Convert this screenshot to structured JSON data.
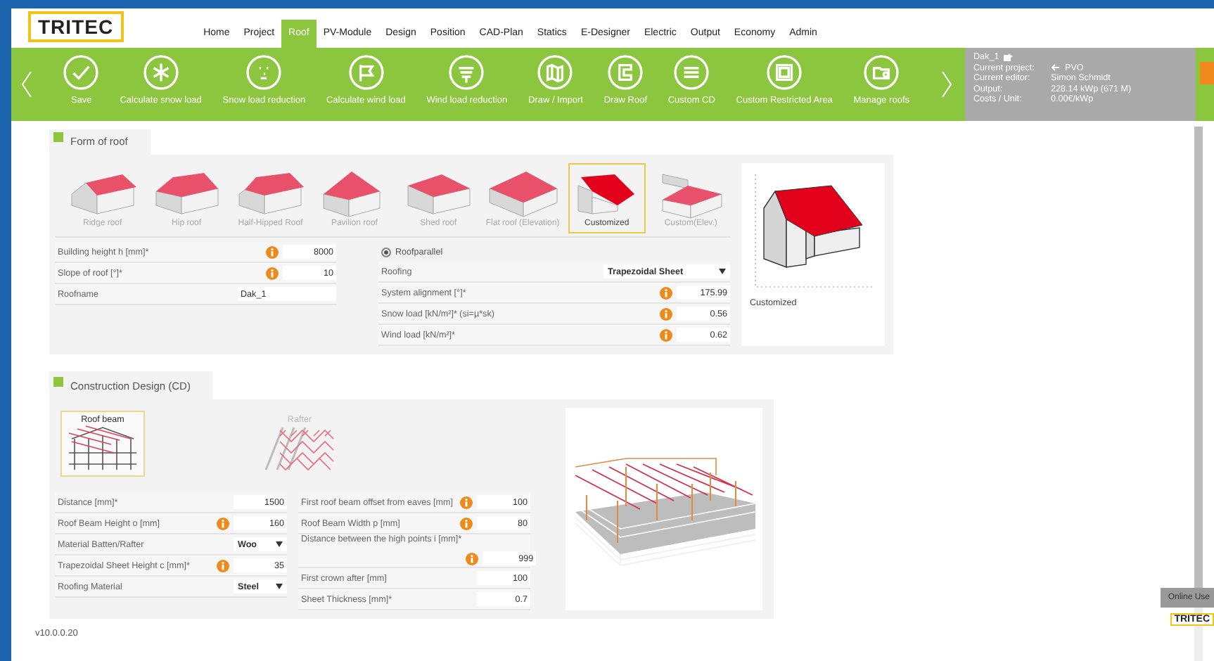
{
  "logo": "TRITEC",
  "nav": [
    {
      "label": "Home",
      "selected": false
    },
    {
      "label": "Project",
      "selected": false
    },
    {
      "label": "Roof",
      "selected": true
    },
    {
      "label": "PV-Module",
      "selected": false
    },
    {
      "label": "Design",
      "selected": false
    },
    {
      "label": "Position",
      "selected": false
    },
    {
      "label": "CAD-Plan",
      "selected": false
    },
    {
      "label": "Statics",
      "selected": false
    },
    {
      "label": "E-Designer",
      "selected": false
    },
    {
      "label": "Electric",
      "selected": false
    },
    {
      "label": "Output",
      "selected": false
    },
    {
      "label": "Economy",
      "selected": false
    },
    {
      "label": "Admin",
      "selected": false
    }
  ],
  "toolbar": [
    {
      "label": "Save"
    },
    {
      "label": "Calculate snow load"
    },
    {
      "label": "Snow load reduction"
    },
    {
      "label": "Calculate wind load"
    },
    {
      "label": "Wind load reduction"
    },
    {
      "label": "Draw / Import"
    },
    {
      "label": "Draw Roof"
    },
    {
      "label": "Custom CD"
    },
    {
      "label": "Custom Restricted Area"
    },
    {
      "label": "Manage roofs"
    }
  ],
  "info": {
    "roof": "Dak_1",
    "lines": [
      {
        "label": "Current project:",
        "value": "PVO",
        "icon": true
      },
      {
        "label": "Current editor:",
        "value": "Simon Schmidt",
        "icon": false
      },
      {
        "label": "Output:",
        "value": "228.14 kWp (671 M)",
        "icon": false
      },
      {
        "label": "Costs / Unit:",
        "value": "0.00€/kWp",
        "icon": false
      }
    ]
  },
  "roof_form": {
    "title": "Form of roof",
    "shapes": [
      {
        "label": "Ridge roof",
        "kind": "ridge",
        "selected": false
      },
      {
        "label": "Hip roof",
        "kind": "hip",
        "selected": false
      },
      {
        "label": "Half-Hipped Roof",
        "kind": "halfhip",
        "selected": false
      },
      {
        "label": "Pavilion roof",
        "kind": "pavilion",
        "selected": false
      },
      {
        "label": "Shed roof",
        "kind": "shed",
        "selected": false
      },
      {
        "label": "Flat roof (Elevation)",
        "kind": "flat",
        "selected": false
      },
      {
        "label": "Customized",
        "kind": "custom",
        "selected": true
      },
      {
        "label": "Custom(Elev.)",
        "kind": "customelev",
        "selected": false
      }
    ],
    "fields_left": [
      {
        "label": "Building height h [mm]*",
        "info": true,
        "kind": "number",
        "value": "8000"
      },
      {
        "label": "Slope of roof [°]*",
        "info": true,
        "kind": "number",
        "value": "10"
      },
      {
        "label": "Roofname",
        "info": false,
        "kind": "text",
        "value": "Dak_1"
      }
    ],
    "fields_right": [
      {
        "label": "Roofparallel",
        "kind": "radio",
        "selected": true
      },
      {
        "label": "Roofing",
        "info": false,
        "kind": "select",
        "value": "Trapezoidal Sheet"
      },
      {
        "label": "System alignment [°]*",
        "info": true,
        "kind": "number",
        "value": "175.99"
      },
      {
        "label": "Snow load [kN/m²]* (si=µ*sk)",
        "info": true,
        "kind": "number",
        "value": "0.56"
      },
      {
        "label": "Wind load [kN/m²]*",
        "info": true,
        "kind": "number",
        "value": "0.62"
      }
    ],
    "preview_caption": "Customized"
  },
  "cd": {
    "title": "Construction Design (CD)",
    "types": [
      {
        "label": "Roof beam",
        "kind": "beam",
        "selected": true
      },
      {
        "label": "Rafter",
        "kind": "rafter",
        "selected": false
      }
    ],
    "fields_left": [
      {
        "label": "Distance [mm]*",
        "info": false,
        "kind": "number",
        "value": "1500"
      },
      {
        "label": "Roof Beam Height o [mm]",
        "info": true,
        "kind": "number",
        "value": "160"
      },
      {
        "label": "Material Batten/Rafter",
        "info": false,
        "kind": "select",
        "value": "Woo"
      },
      {
        "label": "Trapezoidal Sheet Height c [mm]*",
        "info": true,
        "kind": "number",
        "value": "35"
      },
      {
        "label": "Roofing Material",
        "info": false,
        "kind": "select",
        "value": "Steel"
      }
    ],
    "fields_right": [
      {
        "label": "First roof beam offset from eaves [mm]",
        "info": true,
        "kind": "number",
        "value": "100"
      },
      {
        "label": "Roof Beam Width p [mm]",
        "info": true,
        "kind": "number",
        "value": "80"
      },
      {
        "label": "Distance between the high points i [mm]*",
        "info": true,
        "kind": "tall",
        "value": "999"
      },
      {
        "label": "First crown after [mm]",
        "info": false,
        "kind": "number",
        "value": "100"
      },
      {
        "label": "Sheet Thickness [mm]*",
        "info": false,
        "kind": "number",
        "value": "0.7"
      }
    ]
  },
  "version": "v10.0.0.20",
  "online_users": "Online Use",
  "mini_logo": "TRITEC"
}
